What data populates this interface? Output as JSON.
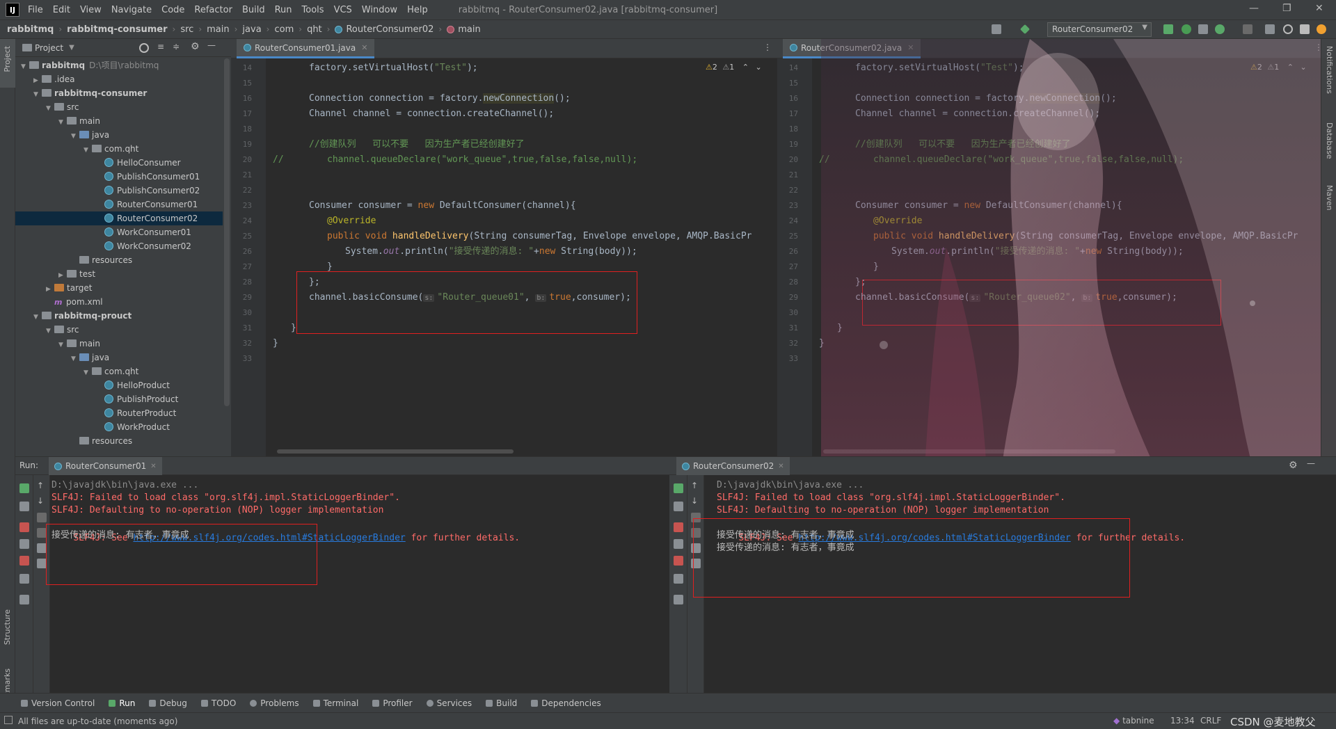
{
  "menubar": {
    "logo": "IJ",
    "items": [
      "File",
      "Edit",
      "View",
      "Navigate",
      "Code",
      "Refactor",
      "Build",
      "Run",
      "Tools",
      "VCS",
      "Window",
      "Help"
    ],
    "window_title": "rabbitmq - RouterConsumer02.java [rabbitmq-consumer]"
  },
  "breadcrumbs": [
    "rabbitmq",
    "rabbitmq-consumer",
    "src",
    "main",
    "java",
    "com",
    "qht",
    "RouterConsumer02",
    "main"
  ],
  "toolbar": {
    "run_config": "RouterConsumer02"
  },
  "left_strip": {
    "project": "Project",
    "structure": "Structure",
    "bookmarks": "Bookmarks"
  },
  "right_strip": {
    "notifications": "Notifications",
    "database": "Database",
    "maven": "Maven"
  },
  "project_panel": {
    "title": "Project",
    "tree": [
      {
        "label": "rabbitmq",
        "extra": "D:\\项目\\rabbitmq",
        "depth": 0,
        "icon": "folder-module",
        "arrow": "down",
        "bold": true
      },
      {
        "label": ".idea",
        "depth": 1,
        "icon": "folder",
        "arrow": "right"
      },
      {
        "label": "rabbitmq-consumer",
        "depth": 1,
        "icon": "folder-module",
        "arrow": "down",
        "bold": true
      },
      {
        "label": "src",
        "depth": 2,
        "icon": "folder",
        "arrow": "down"
      },
      {
        "label": "main",
        "depth": 3,
        "icon": "folder",
        "arrow": "down"
      },
      {
        "label": "java",
        "depth": 4,
        "icon": "folder-blue",
        "arrow": "down"
      },
      {
        "label": "com.qht",
        "depth": 5,
        "icon": "folder",
        "arrow": "down"
      },
      {
        "label": "HelloConsumer",
        "depth": 6,
        "icon": "class"
      },
      {
        "label": "PublishConsumer01",
        "depth": 6,
        "icon": "class"
      },
      {
        "label": "PublishConsumer02",
        "depth": 6,
        "icon": "class"
      },
      {
        "label": "RouterConsumer01",
        "depth": 6,
        "icon": "class"
      },
      {
        "label": "RouterConsumer02",
        "depth": 6,
        "icon": "class",
        "selected": true
      },
      {
        "label": "WorkConsumer01",
        "depth": 6,
        "icon": "class"
      },
      {
        "label": "WorkConsumer02",
        "depth": 6,
        "icon": "class"
      },
      {
        "label": "resources",
        "depth": 4,
        "icon": "folder"
      },
      {
        "label": "test",
        "depth": 3,
        "icon": "folder",
        "arrow": "right"
      },
      {
        "label": "target",
        "depth": 2,
        "icon": "folder-orange",
        "arrow": "right"
      },
      {
        "label": "pom.xml",
        "depth": 2,
        "icon": "maven"
      },
      {
        "label": "rabbitmq-prouct",
        "depth": 1,
        "icon": "folder-module",
        "arrow": "down",
        "bold": true
      },
      {
        "label": "src",
        "depth": 2,
        "icon": "folder",
        "arrow": "down"
      },
      {
        "label": "main",
        "depth": 3,
        "icon": "folder",
        "arrow": "down"
      },
      {
        "label": "java",
        "depth": 4,
        "icon": "folder-blue",
        "arrow": "down"
      },
      {
        "label": "com.qht",
        "depth": 5,
        "icon": "folder",
        "arrow": "down"
      },
      {
        "label": "HelloProduct",
        "depth": 6,
        "icon": "class"
      },
      {
        "label": "PublishProduct",
        "depth": 6,
        "icon": "class"
      },
      {
        "label": "RouterProduct",
        "depth": 6,
        "icon": "class"
      },
      {
        "label": "WorkProduct",
        "depth": 6,
        "icon": "class"
      },
      {
        "label": "resources",
        "depth": 4,
        "icon": "folder"
      }
    ]
  },
  "editor_left": {
    "tab": "RouterConsumer01.java",
    "warnings": "2",
    "weak_warnings": "1",
    "queue_name": "\"Router_queue01\""
  },
  "editor_right": {
    "tab": "RouterConsumer02.java",
    "warnings": "2",
    "weak_warnings": "1",
    "queue_name": "\"Router_queue02\""
  },
  "code": {
    "line_numbers": [
      "14",
      "15",
      "16",
      "17",
      "18",
      "19",
      "20",
      "21",
      "22",
      "23",
      "24",
      "25",
      "26",
      "27",
      "28",
      "29",
      "30",
      "31",
      "32",
      "33"
    ],
    "l14_a": "factory.setVirtualHost(",
    "l14_s": "\"Test\"",
    "l14_b": ");",
    "l16_a": "Connection connection = factory.",
    "l16_fn": "newConnection",
    "l16_b": "();",
    "l17": "Channel channel = connection.createChannel();",
    "l19_cmt": "//创建队列   可以不要   因为生产者已经创建好了",
    "l20_slash": "//",
    "l20_a": "channel.queueDeclare(",
    "l20_s": "\"work_queue\"",
    "l20_c": ",",
    "l20_kw1": "true",
    "l20_kw2": "false",
    "l20_kw3": "false",
    "l20_kw4": "null",
    "l20_b": ");",
    "l23_a": "Consumer consumer = ",
    "l23_kw": "new",
    "l23_b": " DefaultConsumer(channel){",
    "l24": "@Override",
    "l25_kw": "public void ",
    "l25_fn": "handleDelivery",
    "l25_b": "(String consumerTag, Envelope envelope, AMQP.BasicPr",
    "l26_a": "System.",
    "l26_out": "out",
    "l26_b": ".println(",
    "l26_s": "\"接受传递的消息: \"",
    "l26_c": "+",
    "l26_kw": "new",
    "l26_d": " String(body));",
    "l27": "}",
    "l28": "};",
    "l29_a": "channel.basicConsume(",
    "l29_hint1": "s:",
    "l29_c": ", ",
    "l29_hint2": "b:",
    "l29_kw": "true",
    "l29_b": ",consumer);",
    "l31": "}",
    "l32": "}"
  },
  "run_panel": {
    "label": "Run:",
    "left_tab": "RouterConsumer01",
    "right_tab": "RouterConsumer02",
    "cmd": "D:\\javajdk\\bin\\java.exe ...",
    "err1": "SLF4J: Failed to load class \"org.slf4j.impl.StaticLoggerBinder\".",
    "err2": "SLF4J: Defaulting to no-operation (NOP) logger implementation",
    "err3_a": "SLF4J: See ",
    "err3_link": "http://www.slf4j.org/codes.html#StaticLoggerBinder",
    "err3_b": " for further details.",
    "msg": "接受传递的消息: 有志者，事竟成"
  },
  "bottom_tabs": [
    "Version Control",
    "Run",
    "Debug",
    "TODO",
    "Problems",
    "Terminal",
    "Profiler",
    "Services",
    "Build",
    "Dependencies"
  ],
  "status": {
    "message": "All files are up-to-date (moments ago)",
    "tabnine": "tabnine",
    "position": "13:34",
    "line_sep": "CRLF",
    "watermark": "CSDN @麦地教父"
  },
  "colors": {
    "accent": "#4a88c7",
    "error": "#ff6b68",
    "annotation_box": "#e02020",
    "link": "#287bde"
  }
}
